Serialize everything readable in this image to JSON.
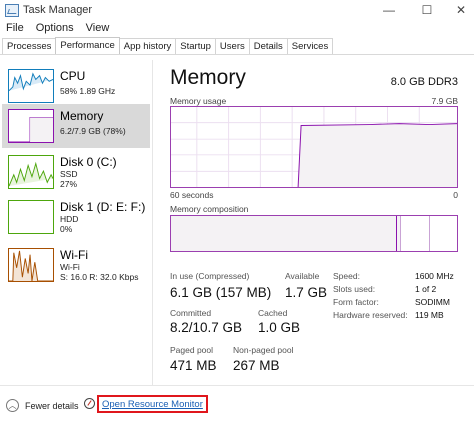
{
  "window": {
    "title": "Task Manager",
    "min": "—",
    "max": "☐",
    "close": "✕"
  },
  "menu": [
    "File",
    "Options",
    "View"
  ],
  "tabs": [
    "Processes",
    "Performance",
    "App history",
    "Startup",
    "Users",
    "Details",
    "Services"
  ],
  "active_tab": "Performance",
  "sidebar": {
    "items": [
      {
        "name": "CPU",
        "sub1": "58%  1.89 GHz",
        "sub2": "",
        "color": "#117dbb"
      },
      {
        "name": "Memory",
        "sub1": "6.2/7.9 GB (78%)",
        "sub2": "",
        "color": "#8b12ae"
      },
      {
        "name": "Disk 0 (C:)",
        "sub1": "SSD",
        "sub2": "27%",
        "color": "#4da60c"
      },
      {
        "name": "Disk 1 (D: E: F:)",
        "sub1": "HDD",
        "sub2": "0%",
        "color": "#4da60c"
      },
      {
        "name": "Wi-Fi",
        "sub1": "Wi-Fi",
        "sub2": "S: 16.0  R: 32.0 Kbps",
        "color": "#a74f01"
      }
    ]
  },
  "main": {
    "title": "Memory",
    "spec": "8.0 GB DDR3",
    "usage_label": "Memory usage",
    "usage_max": "7.9 GB",
    "seconds_label": "60 seconds",
    "zero_label": "0",
    "composition_label": "Memory composition",
    "in_use_fraction": 0.78
  },
  "stats": {
    "in_use_label": "In use (Compressed)",
    "in_use_value": "6.1 GB (157 MB)",
    "available_label": "Available",
    "available_value": "1.7 GB",
    "committed_label": "Committed",
    "committed_value": "8.2/10.7 GB",
    "cached_label": "Cached",
    "cached_value": "1.0 GB",
    "paged_label": "Paged pool",
    "paged_value": "471 MB",
    "nonpaged_label": "Non-paged pool",
    "nonpaged_value": "267 MB"
  },
  "specs": {
    "speed_label": "Speed:",
    "speed_value": "1600 MHz",
    "slots_label": "Slots used:",
    "slots_value": "1 of 2",
    "form_label": "Form factor:",
    "form_value": "SODIMM",
    "reserved_label": "Hardware reserved:",
    "reserved_value": "119 MB"
  },
  "footer": {
    "fewer_details": "Fewer details",
    "resource_monitor": "Open Resource Monitor"
  },
  "colors": {
    "memory": "#8b12ae",
    "memory_fill": "#f4f2f4",
    "link": "#1a5fb4",
    "highlight": "#e0161c"
  }
}
